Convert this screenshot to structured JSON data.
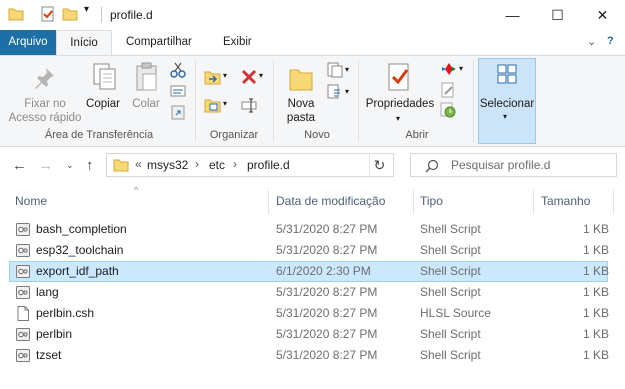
{
  "window": {
    "title": "profile.d",
    "controls": {
      "minimize": "—",
      "maximize": "☐",
      "close": "✕"
    }
  },
  "ribbon": {
    "tabs": [
      {
        "label": "Arquivo",
        "state": "file"
      },
      {
        "label": "Início",
        "state": "active"
      },
      {
        "label": "Compartilhar",
        "state": "normal"
      },
      {
        "label": "Exibir",
        "state": "normal"
      }
    ],
    "groups": {
      "clipboard": {
        "label": "Área de Transferência",
        "pin_label_1": "Fixar no",
        "pin_label_2": "Acesso rápido",
        "copy_label": "Copiar",
        "paste_label": "Colar"
      },
      "organize": {
        "label": "Organizar"
      },
      "new": {
        "label": "Novo",
        "new_folder_1": "Nova",
        "new_folder_2": "pasta"
      },
      "open": {
        "label": "Abrir",
        "properties_label": "Propriedades"
      },
      "select": {
        "label": "Selecionar"
      }
    }
  },
  "address": {
    "overflow": "«",
    "crumbs": [
      "msys32",
      "etc",
      "profile.d"
    ],
    "separator": "›",
    "search_placeholder": "Pesquisar profile.d"
  },
  "columns": {
    "name": "Nome",
    "modified": "Data de modificação",
    "type": "Tipo",
    "size": "Tamanho"
  },
  "files": [
    {
      "name": "bash_completion",
      "modified": "5/31/2020 8:27 PM",
      "type": "Shell Script",
      "size": "1 KB",
      "icon": "shell-script-icon",
      "selected": false
    },
    {
      "name": "esp32_toolchain",
      "modified": "5/31/2020 8:27 PM",
      "type": "Shell Script",
      "size": "1 KB",
      "icon": "shell-script-icon",
      "selected": false
    },
    {
      "name": "export_idf_path",
      "modified": "6/1/2020 2:30 PM",
      "type": "Shell Script",
      "size": "1 KB",
      "icon": "shell-script-icon",
      "selected": true
    },
    {
      "name": "lang",
      "modified": "5/31/2020 8:27 PM",
      "type": "Shell Script",
      "size": "1 KB",
      "icon": "shell-script-icon",
      "selected": false
    },
    {
      "name": "perlbin.csh",
      "modified": "5/31/2020 8:27 PM",
      "type": "HLSL Source",
      "size": "1 KB",
      "icon": "blank-file-icon",
      "selected": false
    },
    {
      "name": "perlbin",
      "modified": "5/31/2020 8:27 PM",
      "type": "Shell Script",
      "size": "1 KB",
      "icon": "shell-script-icon",
      "selected": false
    },
    {
      "name": "tzset",
      "modified": "5/31/2020 8:27 PM",
      "type": "Shell Script",
      "size": "1 KB",
      "icon": "shell-script-icon",
      "selected": false
    }
  ],
  "colors": {
    "file_tab": "#1e6fa8",
    "selection": "#cce8ff",
    "selection_border": "#99d1ff",
    "folder": "#f8d775",
    "header_text": "#4c607a"
  }
}
